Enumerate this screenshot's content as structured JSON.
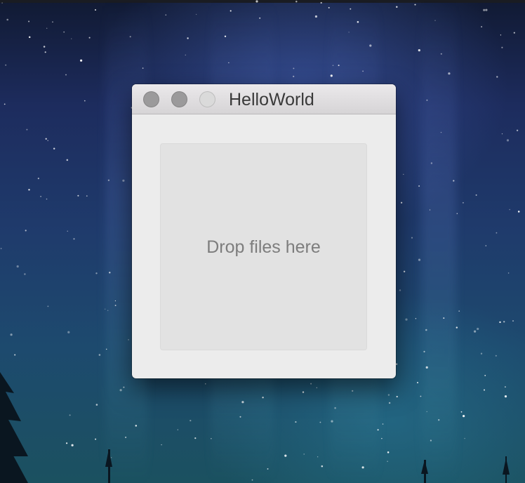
{
  "desktop": {
    "wallpaper": "night-sky-with-stars-and-pine-trees"
  },
  "window": {
    "title": "HelloWorld",
    "controls": {
      "close": "close-button",
      "minimize": "minimize-button",
      "zoom": "zoom-button"
    },
    "drop_zone": {
      "label": "Drop files here"
    }
  },
  "colors": {
    "window_bg": "#ececec",
    "drop_zone_bg": "#e2e2e2",
    "drop_label": "#7d7d7d",
    "title_text": "#3a3a3a"
  }
}
